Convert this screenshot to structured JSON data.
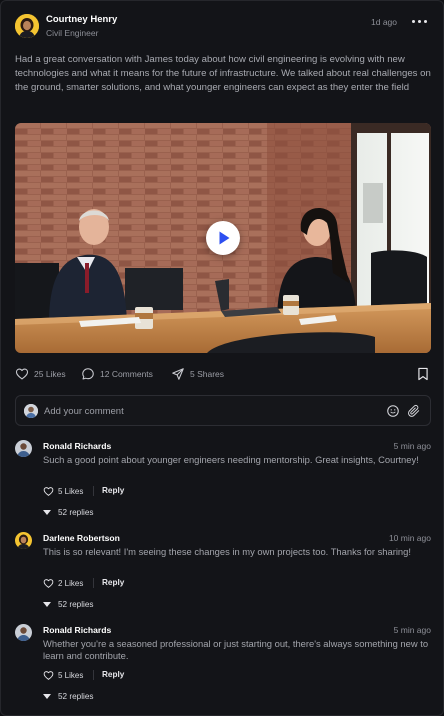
{
  "post": {
    "author_name": "Courtney Henry",
    "author_role": "Civil Engineer",
    "time": "1d ago",
    "text": "Had a great conversation with James today about how civil engineering is evolving with new technologies and what it means for the future of infrastructure. We talked about real challenges on the ground, smarter solutions, and what younger engineers can expect as they enter the field"
  },
  "actions": {
    "likes": "25 Likes",
    "comments": "12 Comments",
    "shares": "5 Shares"
  },
  "comment_input": {
    "placeholder": "Add your comment"
  },
  "comments": [
    {
      "name": "Ronald Richards",
      "time": "5 min ago",
      "text": "Such a good point about younger engineers needing mentorship. Great insights, Courtney!",
      "likes": "5 Likes",
      "reply": "Reply",
      "replies": "52 replies"
    },
    {
      "name": "Darlene Robertson",
      "time": "10 min ago",
      "text": "This is so relevant! I'm seeing these changes in my own projects too. Thanks for sharing!",
      "likes": "2 Likes",
      "reply": "Reply",
      "replies": "52 replies"
    },
    {
      "name": "Ronald Richards",
      "time": "5 min ago",
      "text": "Whether you're a seasoned professional or just starting out, there's always something new to learn and contribute.",
      "likes": "5 Likes",
      "reply": "Reply",
      "replies": "52 replies"
    }
  ],
  "colors": {
    "background": "#131418",
    "accent_play": "#2d4ff0",
    "avatar_yellow": "#f4c431"
  },
  "icons": [
    "more-horizontal-icon",
    "heart-icon",
    "comment-icon",
    "share-icon",
    "bookmark-icon",
    "emoji-icon",
    "paperclip-icon",
    "chevron-down-icon",
    "play-icon"
  ]
}
